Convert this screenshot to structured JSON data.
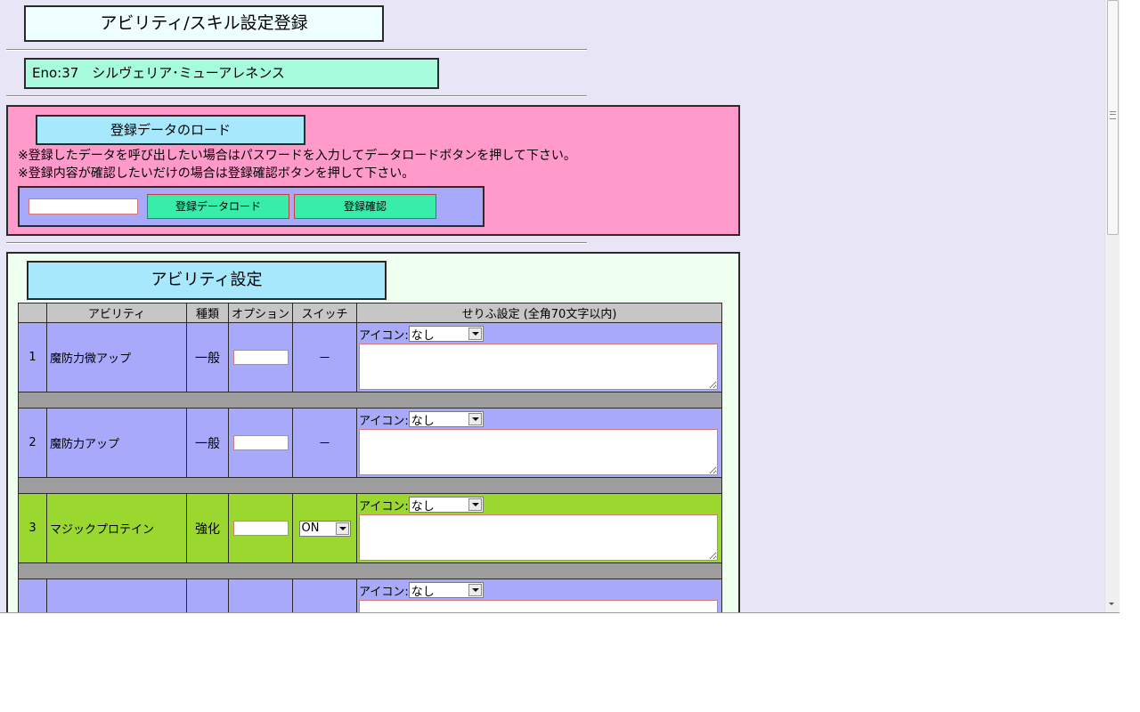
{
  "page_title": "アビリティ/スキル設定登録",
  "character": {
    "label": "Eno:37　シルヴェリア･ミューアレネンス"
  },
  "load_section": {
    "title": "登録データのロード",
    "notes": [
      "※登録したデータを呼び出したい場合はパスワードを入力してデータロードボタンを押して下さい。",
      "※登録内容が確認したいだけの場合は登録確認ボタンを押して下さい。"
    ],
    "password_value": "",
    "load_button": "登録データロード",
    "confirm_button": "登録確認"
  },
  "ability_section": {
    "title": "アビリティ設定",
    "headers": [
      "",
      "アビリティ",
      "種類",
      "オプション",
      "スイッチ",
      "せりふ設定 (全角70文字以内)"
    ],
    "icon_label": "アイコン:",
    "rows": [
      {
        "num": "1",
        "name": "魔防力微アップ",
        "type": "一般",
        "option": "",
        "switch": "－",
        "icon": "なし",
        "line": "",
        "color": "#a9a9fb"
      },
      {
        "num": "2",
        "name": "魔防力アップ",
        "type": "一般",
        "option": "",
        "switch": "－",
        "icon": "なし",
        "line": "",
        "color": "#a9a9fb"
      },
      {
        "num": "3",
        "name": "マジックプロテイン",
        "type": "強化",
        "option": "",
        "switch": "ON",
        "icon": "なし",
        "line": "",
        "color": "#9ad830"
      },
      {
        "num": "",
        "name": "",
        "type": "",
        "option": "",
        "switch": "",
        "icon": "なし",
        "line": "",
        "color": "#a9a9fb"
      }
    ]
  }
}
